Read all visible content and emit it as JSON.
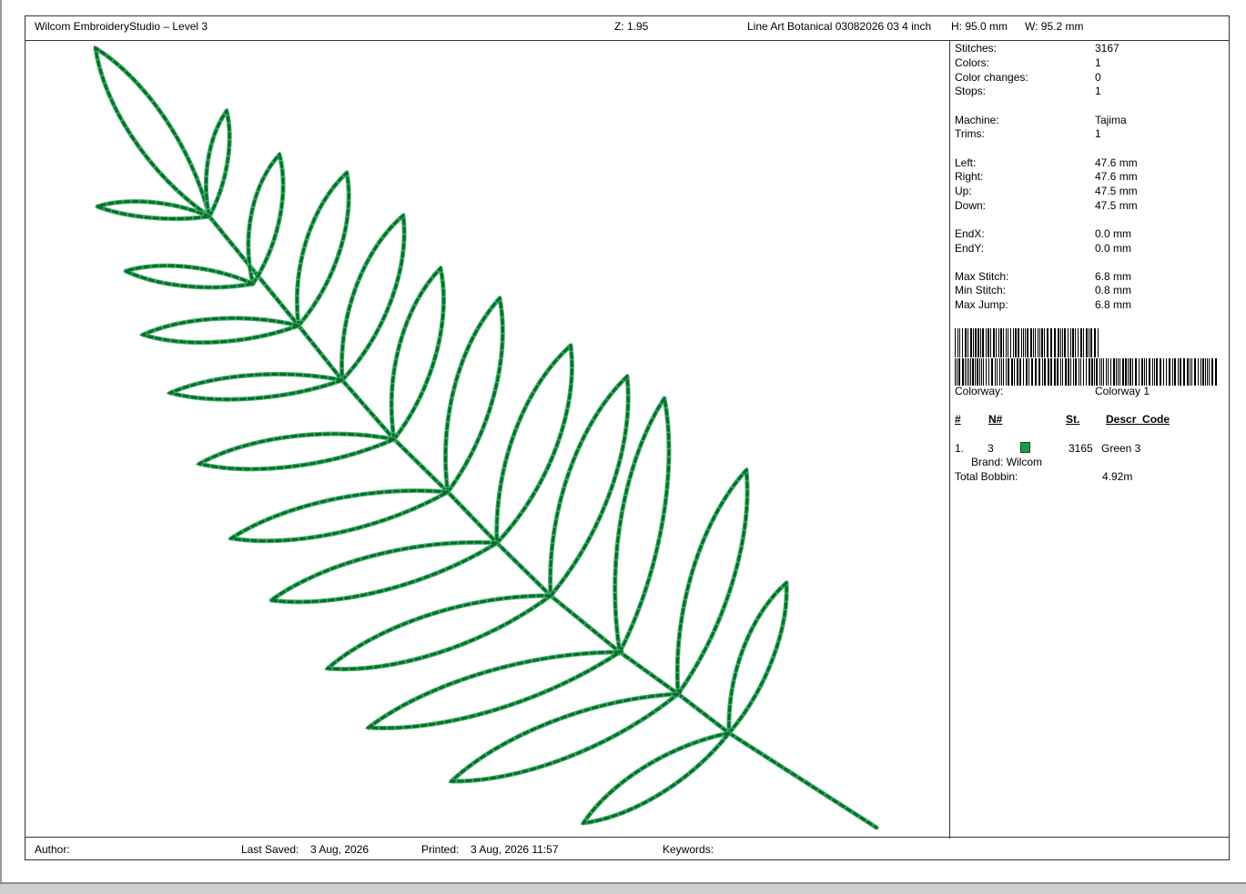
{
  "header": {
    "app_title": "Wilcom EmbroideryStudio – Level 3",
    "zoom": "Z: 1.95",
    "design_name": "Line Art Botanical 03082026 03 4 inch",
    "height": "H: 95.0 mm",
    "width": "W: 95.2 mm"
  },
  "stats": [
    {
      "label": "Stitches:",
      "value": "3167"
    },
    {
      "label": "Colors:",
      "value": "1"
    },
    {
      "label": "Color changes:",
      "value": "0"
    },
    {
      "label": "Stops:",
      "value": "1"
    },
    {
      "label": "Machine:",
      "value": "Tajima"
    },
    {
      "label": "Trims:",
      "value": "1"
    },
    {
      "label": "Left:",
      "value": "47.6 mm"
    },
    {
      "label": "Right:",
      "value": "47.6 mm"
    },
    {
      "label": "Up:",
      "value": "47.5 mm"
    },
    {
      "label": "Down:",
      "value": "47.5 mm"
    },
    {
      "label": "EndX:",
      "value": "0.0 mm"
    },
    {
      "label": "EndY:",
      "value": "0.0 mm"
    },
    {
      "label": "Max Stitch:",
      "value": "6.8 mm"
    },
    {
      "label": "Min Stitch:",
      "value": "0.8 mm"
    },
    {
      "label": "Max Jump:",
      "value": "6.8 mm"
    }
  ],
  "colorway": {
    "label": "Colorway:",
    "value": "Colorway 1"
  },
  "color_table": {
    "headers": {
      "num": "#",
      "n": "N#",
      "st": "St.",
      "descr": "Descr_Code"
    },
    "rows": [
      {
        "idx": "1.",
        "n": "3",
        "swatch_color": "#1f9a4a",
        "st": "3165",
        "descr": "Green 3",
        "brand": "Brand: Wilcom"
      }
    ]
  },
  "bobbin": {
    "label": "Total Bobbin:",
    "value": "4.92m"
  },
  "footer": {
    "author_label": "Author:",
    "last_saved_label": "Last Saved:",
    "last_saved_value": "3 Aug, 2026",
    "printed_label": "Printed:",
    "printed_value": "3 Aug, 2026 11:57",
    "keywords_label": "Keywords:"
  },
  "thread_colors": {
    "dark": "#0e6a30",
    "light": "#3fb56a"
  }
}
